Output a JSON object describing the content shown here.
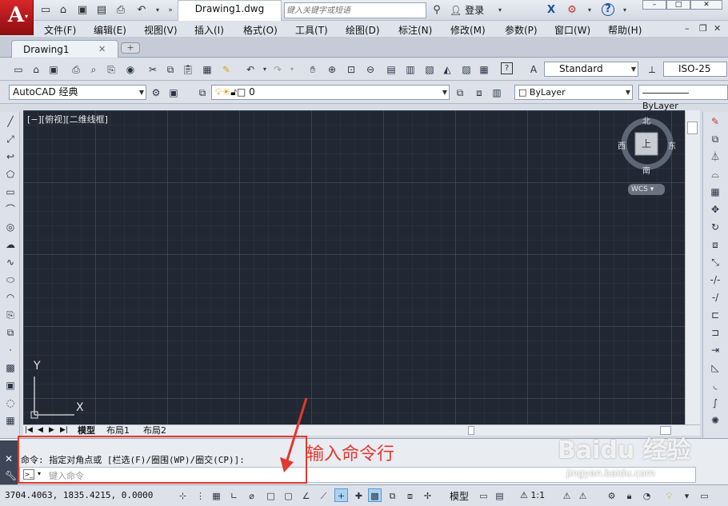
{
  "titlebar": {
    "doc_title": "Drawing1.dwg",
    "search_placeholder": "键入关键字或短语",
    "login": "登录"
  },
  "menu": [
    "文件(F)",
    "编辑(E)",
    "视图(V)",
    "插入(I)",
    "格式(O)",
    "工具(T)",
    "绘图(D)",
    "标注(N)",
    "修改(M)",
    "参数(P)",
    "窗口(W)",
    "帮助(H)"
  ],
  "tabs": {
    "drawing_tab": "Drawing1"
  },
  "toolbar": {
    "text_style": "Standard",
    "dim_style": "ISO-25",
    "workspace": "AutoCAD 经典",
    "layer": "0",
    "color": "ByLayer",
    "linetype": "ByLayer"
  },
  "viewport": {
    "view_label": "[−][俯视][二维线框]",
    "compass": {
      "north": "北",
      "south": "南",
      "east": "东",
      "west": "西",
      "center": "上"
    },
    "wcs": "WCS",
    "ucs_x": "X",
    "ucs_y": "Y"
  },
  "layout_tabs": [
    "模型",
    "布局1",
    "布局2"
  ],
  "command": {
    "history": "命令: 指定对角点或 [栏选(F)/圈围(WP)/圈交(CP)]:",
    "input_placeholder": "键入命令"
  },
  "annotation": {
    "label": "输入命令行"
  },
  "statusbar": {
    "coords": "3704.4063, 1835.4215, 0.0000",
    "model": "模型",
    "scale": "1:1"
  },
  "watermark": {
    "brand": "Baidu 经验",
    "url": "jingyan.baidu.com"
  },
  "colors": {
    "canvas_bg": "#212833",
    "annotation": "#e0392f",
    "logo_red": "#c8191d"
  }
}
